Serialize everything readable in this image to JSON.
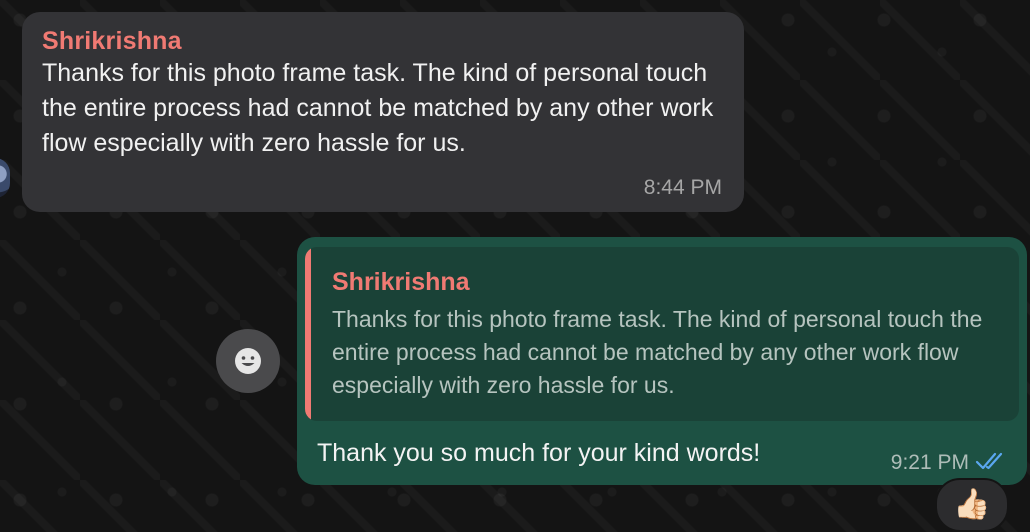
{
  "incoming": {
    "sender": "Shrikrishna",
    "text": "Thanks for this photo frame task. The kind of personal touch the entire process had cannot be matched by any other work flow especially with zero hassle for us.",
    "time": "8:44 PM"
  },
  "outgoing": {
    "quoted_sender": "Shrikrishna",
    "quoted_text": "Thanks for this photo frame task. The kind of personal touch the entire process had cannot be matched by any other work flow especially with zero hassle for us.",
    "reply_text": "Thank you so much for your kind words!",
    "time": "9:21 PM",
    "status_icon": "double-check-icon",
    "status_color": "#5aa7f0"
  },
  "reaction": {
    "emoji": "👍🏻"
  },
  "colors": {
    "sender_name": "#f07a73",
    "incoming_bubble": "#333336",
    "outgoing_bubble": "#1d5143"
  }
}
